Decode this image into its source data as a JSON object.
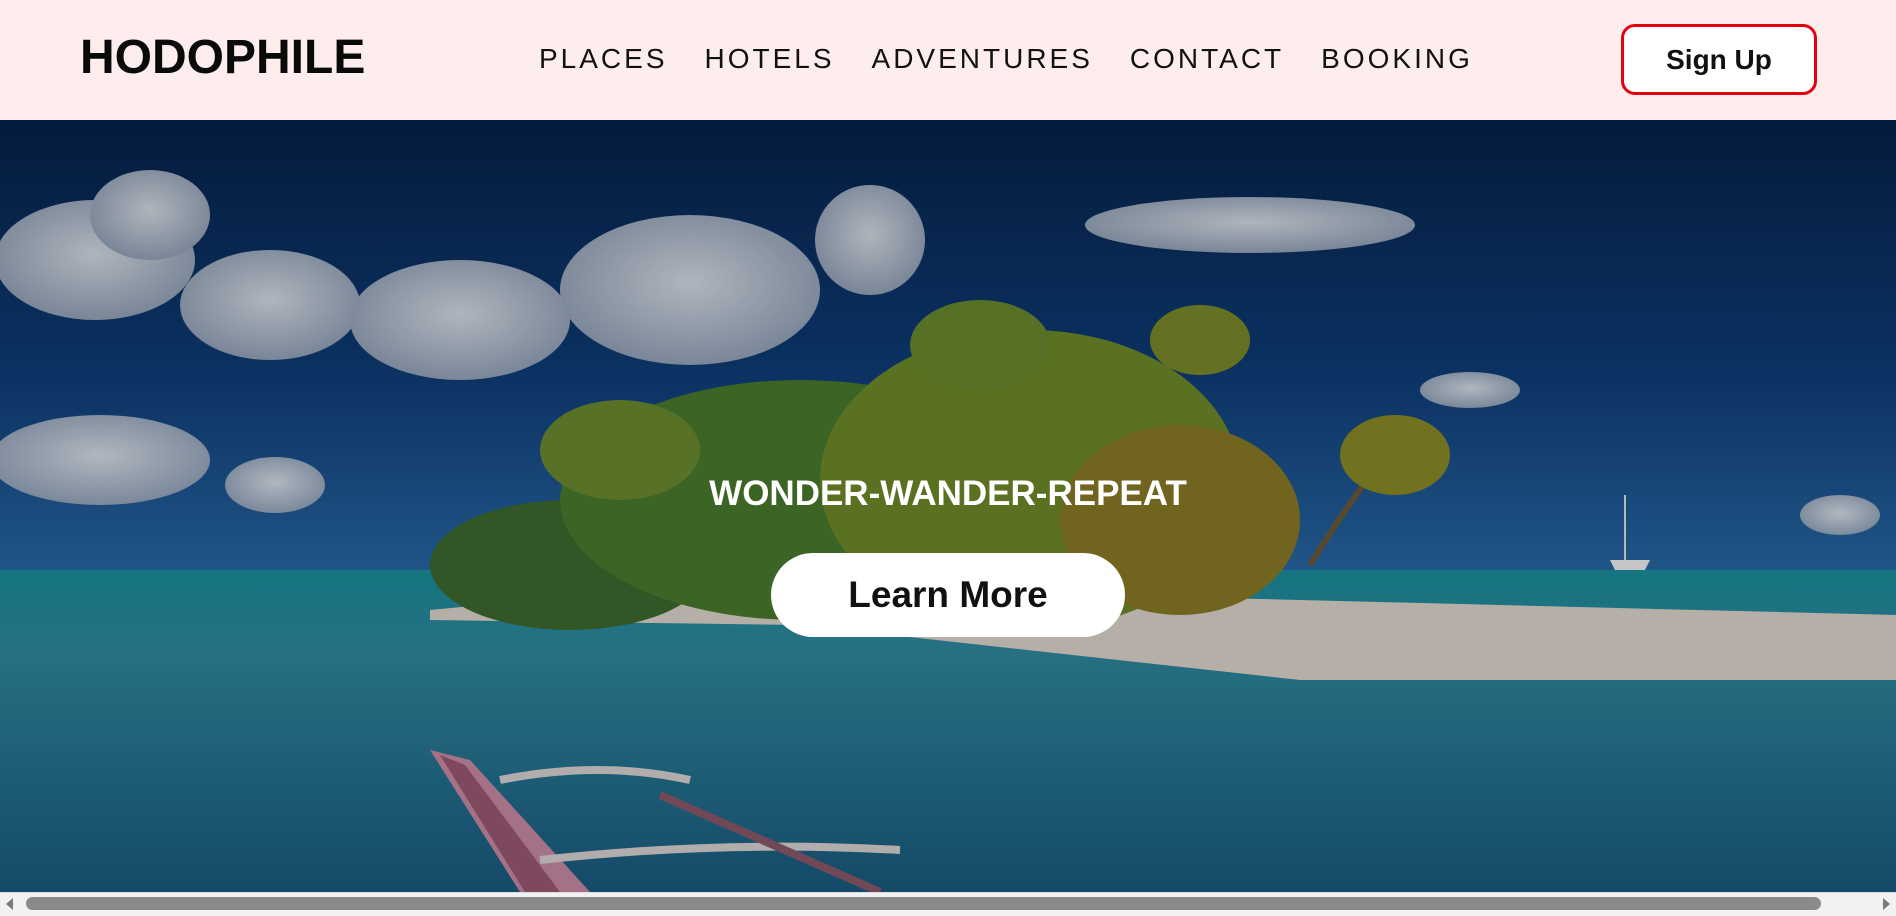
{
  "navbar": {
    "logo": "HODOPHILE",
    "links": [
      "PLACES",
      "HOTELS",
      "ADVENTURES",
      "CONTACT",
      "BOOKING"
    ],
    "signup_label": "Sign Up"
  },
  "hero": {
    "tagline": "WONDER-WANDER-REPEAT",
    "button_label": "Learn More",
    "image": "tropical-island-beach-photo"
  },
  "colors": {
    "navbar_bg": "#fdeded",
    "signup_border": "#e3000f",
    "text": "#111111"
  }
}
